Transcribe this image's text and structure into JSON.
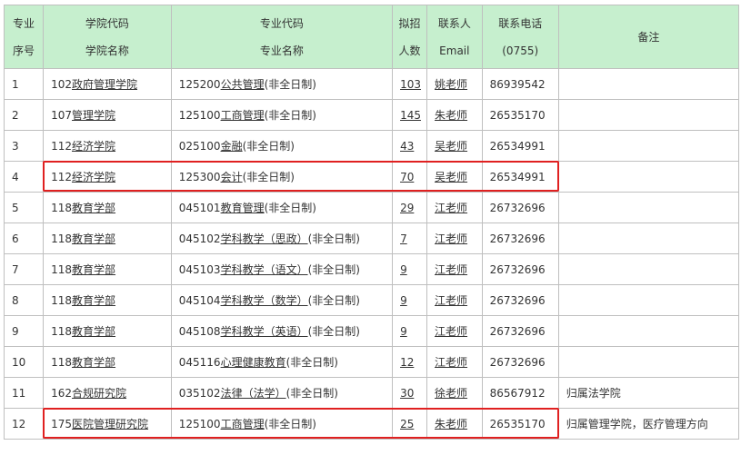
{
  "header": {
    "seq": [
      "专业",
      "序号"
    ],
    "college": [
      "学院代码",
      "学院名称"
    ],
    "major": [
      "专业代码",
      "专业名称"
    ],
    "quota": [
      "拟招",
      "人数"
    ],
    "contact": [
      "联系人",
      "Email"
    ],
    "phone": [
      "联系电话",
      "(0755)"
    ],
    "note": "备注"
  },
  "rows": [
    {
      "seq": "1",
      "college_code": "102",
      "college_name": "政府管理学院",
      "major_code": "125200",
      "major_name": "公共管理",
      "major_suffix": "(非全日制)",
      "quota": "103",
      "contact": "姚老师",
      "phone": "86939542",
      "note": ""
    },
    {
      "seq": "2",
      "college_code": "107",
      "college_name": "管理学院",
      "major_code": "125100",
      "major_name": "工商管理",
      "major_suffix": "(非全日制)",
      "quota": "145",
      "contact": "朱老师",
      "phone": "26535170",
      "note": ""
    },
    {
      "seq": "3",
      "college_code": "112",
      "college_name": "经济学院",
      "major_code": "025100",
      "major_name": "金融",
      "major_suffix": "(非全日制)",
      "quota": "43",
      "contact": "吴老师",
      "phone": "26534991",
      "note": ""
    },
    {
      "seq": "4",
      "college_code": "112",
      "college_name": "经济学院",
      "major_code": "125300",
      "major_name": "会计",
      "major_suffix": "(非全日制)",
      "quota": "70",
      "contact": "吴老师",
      "phone": "26534991",
      "note": ""
    },
    {
      "seq": "5",
      "college_code": "118",
      "college_name": "教育学部",
      "major_code": "045101",
      "major_name": "教育管理",
      "major_suffix": "(非全日制)",
      "quota": "29",
      "contact": "江老师",
      "phone": "26732696",
      "note": ""
    },
    {
      "seq": "6",
      "college_code": "118",
      "college_name": "教育学部",
      "major_code": "045102",
      "major_name": "学科教学（思政）",
      "major_suffix": "(非全日制)",
      "quota": "7",
      "contact": "江老师",
      "phone": "26732696",
      "note": ""
    },
    {
      "seq": "7",
      "college_code": "118",
      "college_name": "教育学部",
      "major_code": "045103",
      "major_name": "学科教学（语文）",
      "major_suffix": "(非全日制)",
      "quota": "9",
      "contact": "江老师",
      "phone": "26732696",
      "note": ""
    },
    {
      "seq": "8",
      "college_code": "118",
      "college_name": "教育学部",
      "major_code": "045104",
      "major_name": "学科教学（数学）",
      "major_suffix": "(非全日制)",
      "quota": "9",
      "contact": "江老师",
      "phone": "26732696",
      "note": ""
    },
    {
      "seq": "9",
      "college_code": "118",
      "college_name": "教育学部",
      "major_code": "045108",
      "major_name": "学科教学（英语）",
      "major_suffix": "(非全日制)",
      "quota": "9",
      "contact": "江老师",
      "phone": "26732696",
      "note": ""
    },
    {
      "seq": "10",
      "college_code": "118",
      "college_name": "教育学部",
      "major_code": "045116",
      "major_name": "心理健康教育",
      "major_suffix": "(非全日制)",
      "quota": "12",
      "contact": "江老师",
      "phone": "26732696",
      "note": ""
    },
    {
      "seq": "11",
      "college_code": "162",
      "college_name": "合规研究院",
      "major_code": "035102",
      "major_name": "法律（法学）",
      "major_suffix": "(非全日制)",
      "quota": "30",
      "contact": "徐老师",
      "phone": "86567912",
      "note": "归属法学院"
    },
    {
      "seq": "12",
      "college_code": "175",
      "college_name": "医院管理研究院",
      "major_code": "125100",
      "major_name": "工商管理",
      "major_suffix": "(非全日制)",
      "quota": "25",
      "contact": "朱老师",
      "phone": "26535170",
      "note": "归属管理学院，医疗管理方向"
    }
  ],
  "highlight_color": "#e02020",
  "header_bg": "#c6efce"
}
